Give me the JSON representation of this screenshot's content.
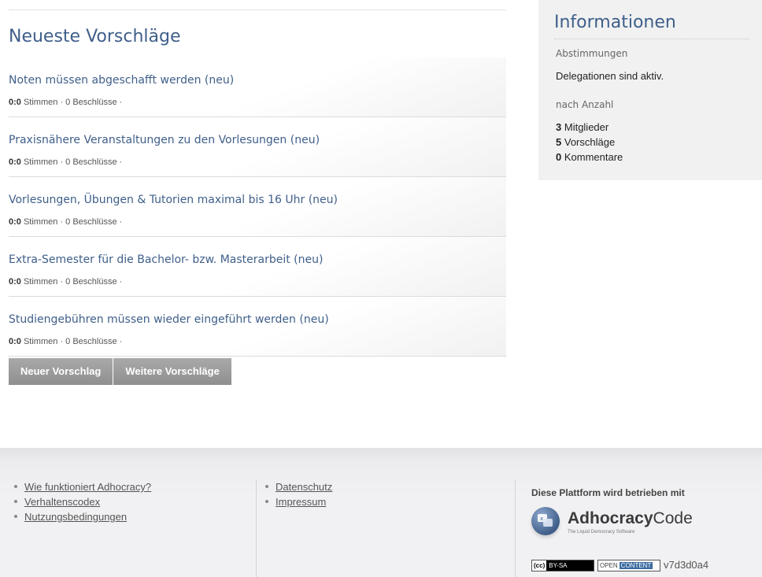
{
  "main": {
    "title": "Neueste Vorschläge",
    "proposals": [
      {
        "title": "Noten müssen abgeschafft werden (neu)",
        "votes": "0:0",
        "votes_label": "Stimmen",
        "decisions": "· 0 Beschlüsse ·"
      },
      {
        "title": "Praxisnähere Veranstaltungen zu den Vorlesungen (neu)",
        "votes": "0:0",
        "votes_label": "Stimmen",
        "decisions": "· 0 Beschlüsse ·"
      },
      {
        "title": "Vorlesungen, Übungen & Tutorien maximal bis 16 Uhr (neu)",
        "votes": "0:0",
        "votes_label": "Stimmen",
        "decisions": "· 0 Beschlüsse ·"
      },
      {
        "title": "Extra-Semester für die Bachelor- bzw. Masterarbeit (neu)",
        "votes": "0:0",
        "votes_label": "Stimmen",
        "decisions": "· 0 Beschlüsse ·"
      },
      {
        "title": "Studiengebühren müssen wieder eingeführt werden (neu)",
        "votes": "0:0",
        "votes_label": "Stimmen",
        "decisions": "· 0 Beschlüsse ·"
      }
    ],
    "buttons": {
      "new": "Neuer Vorschlag",
      "more": "Weitere Vorschläge"
    }
  },
  "sidebar": {
    "title": "Informationen",
    "voting_heading": "Abstimmungen",
    "delegation_text": "Delegationen sind aktiv.",
    "count_heading": "nach Anzahl",
    "stats": [
      {
        "value": "3",
        "label": "Mitglieder"
      },
      {
        "value": "5",
        "label": "Vorschläge"
      },
      {
        "value": "0",
        "label": "Kommentare"
      }
    ]
  },
  "footer": {
    "links_left": [
      "Wie funktioniert Adhocracy?",
      "Verhaltenscodex",
      "Nutzungsbedingungen"
    ],
    "links_mid": [
      "Datenschutz",
      "Impressum"
    ],
    "powered_by": "Diese Plattform wird betrieben mit",
    "logo": {
      "name_a": "Adhocracy",
      "name_b": "Code",
      "tagline": "The Liquid Democracy Software",
      "icon": "adhocracy-logo-icon"
    },
    "badge_cc": {
      "box": "(cc)",
      "text": "BY-SA"
    },
    "badge_oc": {
      "a": "OPEN",
      "b": "CONTENT"
    },
    "version": "v7d3d0a4"
  },
  "colors": {
    "accent": "#3f5f8a",
    "button": "#9a9a9a",
    "sidebar_bg": "#f1f1f1"
  }
}
